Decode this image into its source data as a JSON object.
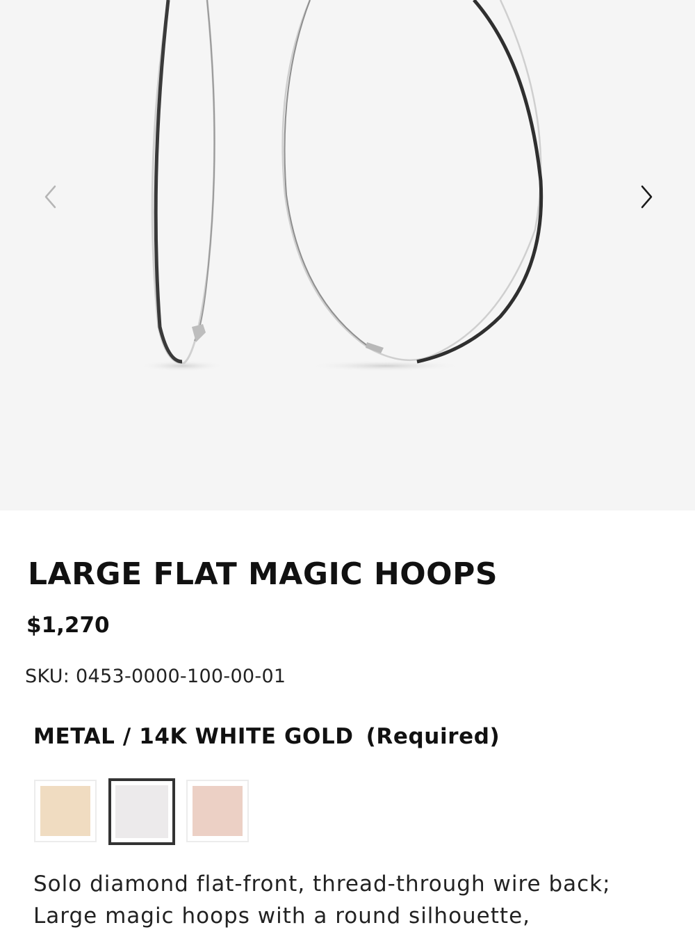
{
  "gallery": {
    "image_name": "large-flat-magic-hoops-image",
    "prev_icon": "chevron-left-icon",
    "next_icon": "chevron-right-icon"
  },
  "product": {
    "title": "LARGE FLAT MAGIC HOOPS",
    "price": "$1,270",
    "sku": "SKU: 0453-0000-100-00-01"
  },
  "option": {
    "label": "METAL / 14K WHITE GOLD",
    "required": "(Required)",
    "swatches": [
      {
        "color": "#f0dcc1",
        "selected": false
      },
      {
        "color": "#eceaeb",
        "selected": true
      },
      {
        "color": "#ecd0c5",
        "selected": false
      }
    ]
  },
  "description": {
    "line1": "Solo diamond flat-front, thread-through wire back;",
    "line2": "Large magic hoops with a round silhouette,"
  },
  "colors": {
    "gallery_bg": "#f5f5f5",
    "text": "#111111",
    "selected_border": "#333333"
  }
}
